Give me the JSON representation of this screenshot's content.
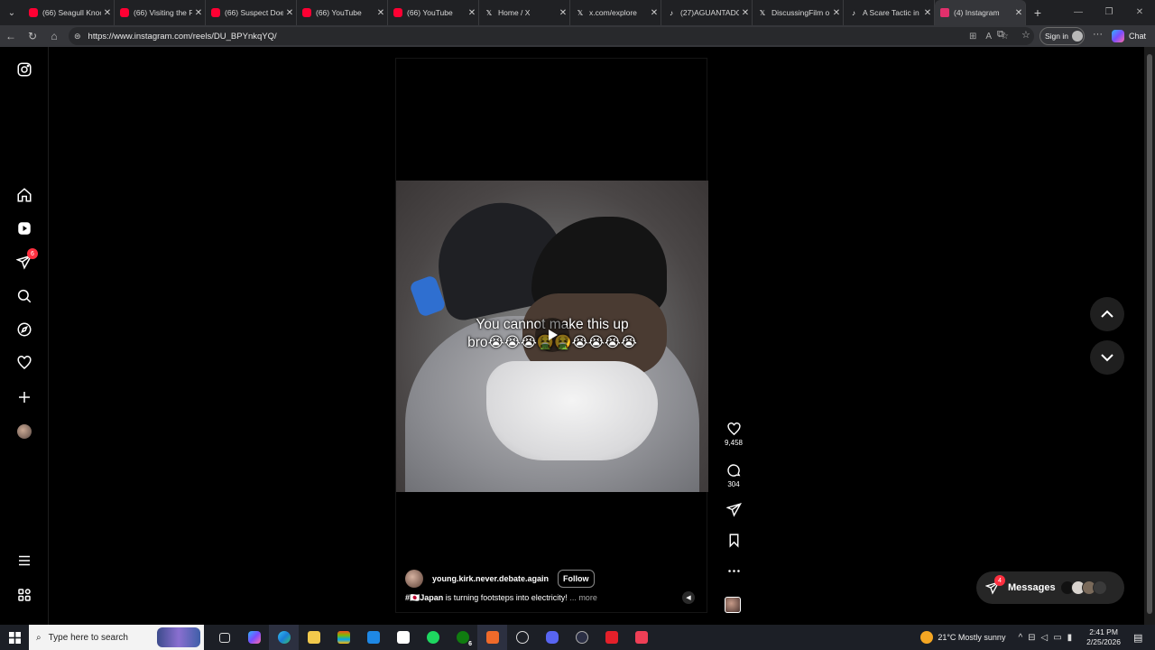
{
  "browser": {
    "tabs": [
      {
        "title": "(66) Seagull Knoc",
        "icon": "youtube-icon",
        "color": "#ff0033"
      },
      {
        "title": "(66) Visiting the F",
        "icon": "youtube-icon",
        "color": "#ff0033"
      },
      {
        "title": "(66) Suspect Doe",
        "icon": "youtube-icon",
        "color": "#ff0033"
      },
      {
        "title": "(66) YouTube",
        "icon": "youtube-icon",
        "color": "#ff0033"
      },
      {
        "title": "(66) YouTube",
        "icon": "youtube-icon",
        "color": "#ff0033"
      },
      {
        "title": "Home / X",
        "icon": "x-logo-icon",
        "color": "#ffffff"
      },
      {
        "title": "x.com/explore",
        "icon": "globe-icon",
        "color": "#ffffff"
      },
      {
        "title": "(27)AGUANTADO",
        "icon": "tiktok-icon",
        "color": "#ffffff"
      },
      {
        "title": "DiscussingFilm o",
        "icon": "x-logo-icon",
        "color": "#ffffff"
      },
      {
        "title": "A Scare Tactic in F",
        "icon": "tiktok-icon",
        "color": "#ffffff"
      },
      {
        "title": "(4) Instagram",
        "icon": "instagram-icon",
        "color": "#e1306c",
        "active": true
      }
    ],
    "url": "https://www.instagram.com/reels/DU_BPYnkqYQ/",
    "sign_in": "Sign in",
    "copilot_label": "Chat"
  },
  "sidebar": {
    "notifications_badge": "6"
  },
  "reel": {
    "overlay_line1": "You cannot make this up",
    "overlay_line2": "bro😭😭😭🤮🤮😭😭😭😭",
    "username": "young.kirk.never.debate.again",
    "follow_label": "Follow",
    "hashtag": "#🇯🇵Japan",
    "caption": " is turning footsteps into electricity!",
    "more_label": "... more",
    "likes": "9,458",
    "comments": "304"
  },
  "messages": {
    "label": "Messages",
    "badge": "4"
  },
  "taskbar": {
    "search_placeholder": "Type here to search",
    "weather": "21°C  Mostly sunny",
    "time": "2:41 PM",
    "date": "2/25/2026",
    "xbox_badge": "6"
  }
}
